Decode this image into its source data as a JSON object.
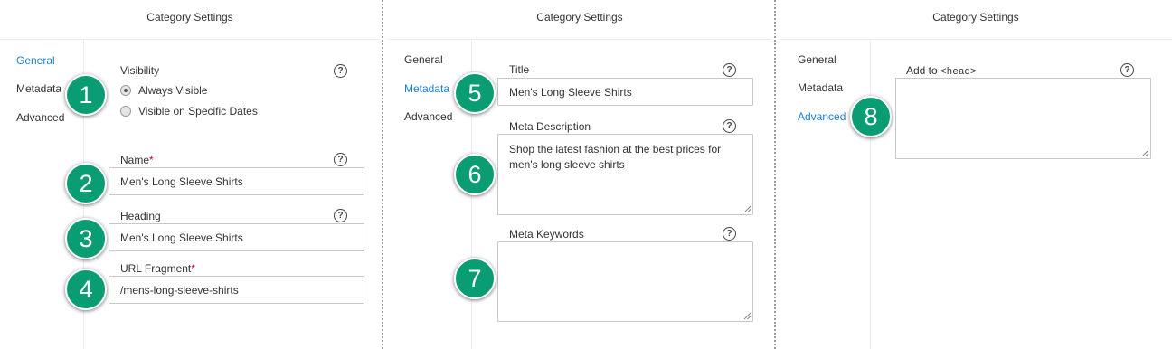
{
  "panels": [
    {
      "title": "Category Settings",
      "nav": [
        "General",
        "Metadata",
        "Advanced"
      ],
      "active_nav": 0,
      "visibility": {
        "label": "Visibility",
        "options": [
          "Always Visible",
          "Visible on Specific Dates"
        ],
        "selected": 0
      },
      "name": {
        "label": "Name",
        "required_mark": "*",
        "value": "Men's Long Sleeve Shirts"
      },
      "heading": {
        "label": "Heading",
        "value": "Men's Long Sleeve Shirts"
      },
      "url_fragment": {
        "label": "URL Fragment",
        "required_mark": "*",
        "value": "/mens-long-sleeve-shirts"
      },
      "badges": [
        "1",
        "2",
        "3",
        "4"
      ]
    },
    {
      "title": "Category Settings",
      "nav": [
        "General",
        "Metadata",
        "Advanced"
      ],
      "active_nav": 1,
      "title_field": {
        "label": "Title",
        "value": "Men's Long Sleeve Shirts"
      },
      "meta_description": {
        "label": "Meta Description",
        "value": "Shop the latest fashion at the best prices for men's long sleeve shirts"
      },
      "meta_keywords": {
        "label": "Meta Keywords",
        "value": ""
      },
      "badges": [
        "5",
        "6",
        "7"
      ]
    },
    {
      "title": "Category Settings",
      "nav": [
        "General",
        "Metadata",
        "Advanced"
      ],
      "active_nav": 2,
      "head_field": {
        "label_prefix": "Add to ",
        "label_code": "<head>",
        "value": ""
      },
      "badges": [
        "8"
      ]
    }
  ],
  "help_icon": "?",
  "colors": {
    "accent_link": "#1a7fd4",
    "badge_green": "#0a9c73",
    "required_red": "#d0021b"
  }
}
